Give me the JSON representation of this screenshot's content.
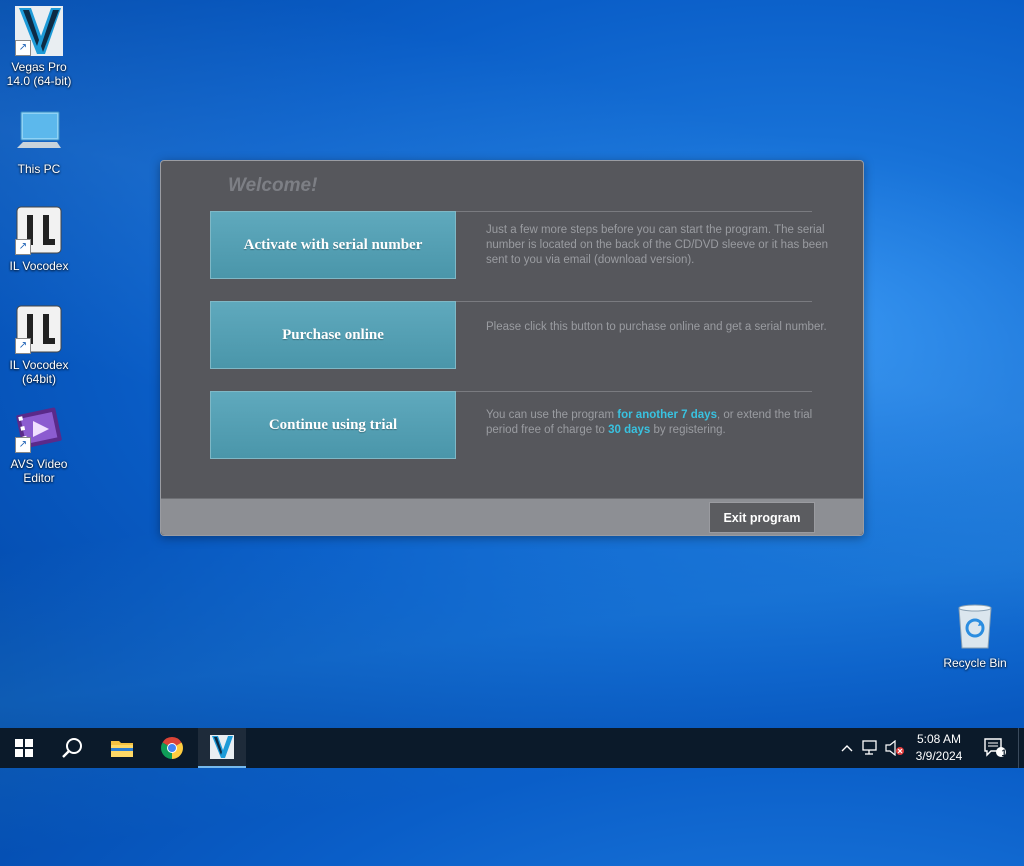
{
  "desktop": {
    "icons": [
      {
        "label": "Vegas Pro 14.0 (64-bit)",
        "icon": "vegas-pro-icon"
      },
      {
        "label": "This PC",
        "icon": "computer-icon"
      },
      {
        "label": "IL Vocodex",
        "icon": "il-vocodex-icon"
      },
      {
        "label": "IL Vocodex (64bit)",
        "icon": "il-vocodex-icon"
      },
      {
        "label": "AVS Video Editor",
        "icon": "avs-video-editor-icon"
      },
      {
        "label": "Recycle Bin",
        "icon": "recycle-bin-icon"
      }
    ]
  },
  "dialog": {
    "title": "Welcome!",
    "options": [
      {
        "label": "Activate with serial number",
        "description": "Just a few more steps before you can start the program. The serial number is located on the back of the CD/DVD sleeve or it has been sent to you via email (download version)."
      },
      {
        "label": "Purchase online",
        "description": "Please click this button to purchase online and get a serial number."
      },
      {
        "label": "Continue using trial",
        "desc_part1": "You can use the program ",
        "desc_hl1": "for another 7 days",
        "desc_part2": ", or extend the trial period free of charge to ",
        "desc_hl2": "30 days",
        "desc_part3": " by registering."
      }
    ],
    "exit_label": "Exit program"
  },
  "taskbar": {
    "items": [
      "start-icon",
      "search-icon",
      "file-explorer-icon",
      "chrome-icon",
      "vegas-pro-icon"
    ],
    "tray_icons": [
      "chevron-up-icon",
      "network-icon",
      "volume-muted-icon"
    ],
    "time": "5:08 AM",
    "date": "3/9/2024",
    "notification_count": "1"
  },
  "colors": {
    "desktop": "#0a5ec8",
    "dialog_bg": "#56575c",
    "button": "#4f9aae",
    "highlight": "#39c2e0"
  }
}
